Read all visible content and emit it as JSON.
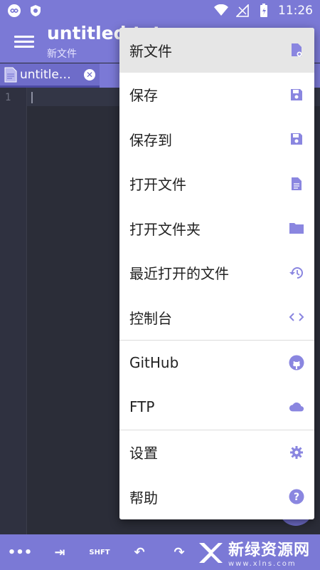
{
  "status_bar": {
    "time": "11:26"
  },
  "app_bar": {
    "title": "untitled.txt",
    "subtitle": "新文件"
  },
  "tab": {
    "label": "untitled.txt"
  },
  "editor": {
    "line_number": "1"
  },
  "bottom_toolbar": {
    "more": "•••",
    "indent": "⇥",
    "shift": "SHFT",
    "undo": "↶",
    "redo": "↷"
  },
  "watermark": {
    "brand": "新绿资源网",
    "domain": "www.xlns.com"
  },
  "menu": {
    "items": [
      {
        "label": "新文件",
        "icon": "new-file-icon"
      },
      {
        "label": "保存",
        "icon": "save-icon"
      },
      {
        "label": "保存到",
        "icon": "save-as-icon"
      },
      {
        "label": "打开文件",
        "icon": "file-icon"
      },
      {
        "label": "打开文件夹",
        "icon": "folder-icon"
      },
      {
        "label": "最近打开的文件",
        "icon": "history-icon"
      },
      {
        "label": "控制台",
        "icon": "code-icon"
      },
      {
        "label": "GitHub",
        "icon": "github-icon"
      },
      {
        "label": "FTP",
        "icon": "cloud-icon"
      },
      {
        "label": "设置",
        "icon": "gear-icon"
      },
      {
        "label": "帮助",
        "icon": "help-icon"
      }
    ]
  },
  "colors": {
    "primary": "#7b79d6",
    "icon": "#8a86e0",
    "editor_bg": "#2b2d38",
    "highlight": "#e6e6e6"
  }
}
